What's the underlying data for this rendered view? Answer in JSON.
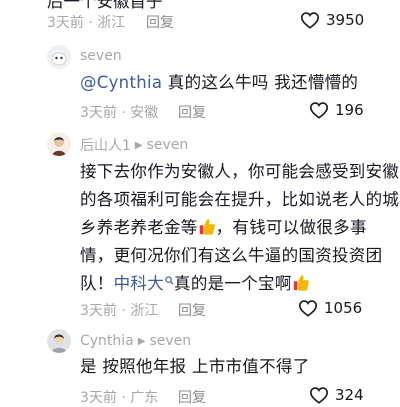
{
  "comments": [
    {
      "partial_text": "后一个安徽首子",
      "meta": "3天前 · 浙江",
      "reply": "回复",
      "likes": "3950"
    },
    {
      "user": "seven",
      "mention": "@Cynthia",
      "text": " 真的这么牛吗 我还懵懵的",
      "meta": "3天前 · 安徽",
      "reply": "回复",
      "likes": "196"
    },
    {
      "user": "后山人1",
      "reply_to": "seven",
      "text_1": "接下去你作为安徽人，你可能会感受到安徽",
      "text_2": "的各项福利可能会在提升，比如说老人的城",
      "text_3a": "乡养老养老金等",
      "text_3b": "，有钱可以做很多事",
      "text_4": "情，更何况你们有这么牛逼的国资投资团",
      "text_5a": "队！",
      "link": "中科大",
      "text_5b": "真的是一个宝啊",
      "meta": "3天前 · 浙江",
      "reply": "回复",
      "likes": "1056"
    },
    {
      "user": "Cynthia",
      "reply_to": "seven",
      "text": "是 按照他年报 上市市值不得了",
      "meta": "3天前 · 广东",
      "reply": "回复",
      "likes": "324"
    }
  ],
  "icons": {
    "like": "heart-outline-icon",
    "reply_arrow": "play-triangle-icon",
    "emoji": "thumbs-up-emoji",
    "link_search": "search-icon"
  },
  "colors": {
    "text": "#161823",
    "muted": "#a4a7ad",
    "link": "#3d5a99",
    "emoji": "#f7b500"
  }
}
